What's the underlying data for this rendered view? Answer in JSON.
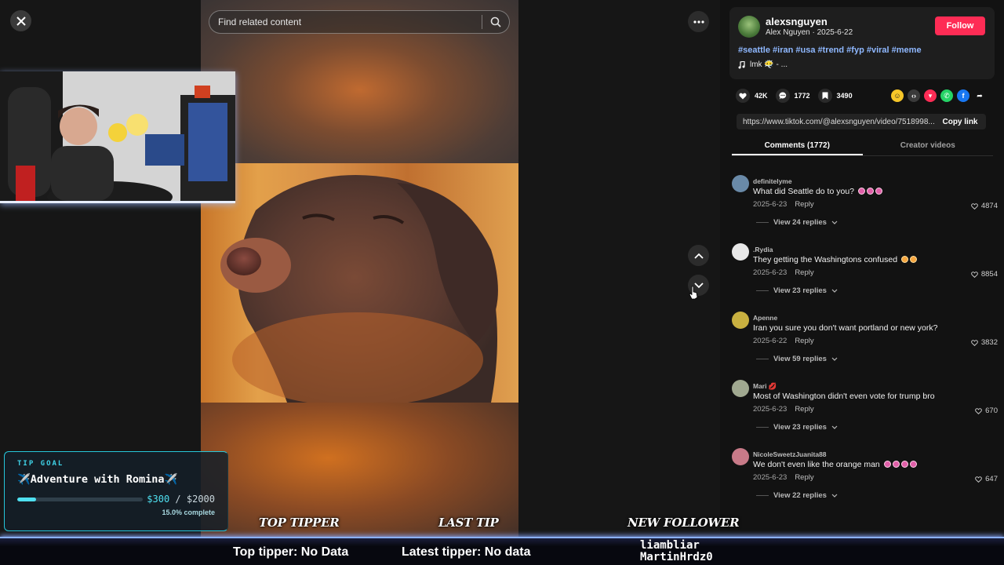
{
  "search": {
    "placeholder": "Find related content"
  },
  "author": {
    "username": "alexsnguyen",
    "display_name": "Alex Nguyen",
    "date": "2025-6-22",
    "follow_label": "Follow",
    "hashtags": "#seattle #iran #usa #trend #fyp #viral #meme",
    "music": "lmk 😶‍🌫️ - ..."
  },
  "stats": {
    "likes": "42K",
    "comments": "1772",
    "saves": "3490"
  },
  "share_icons": [
    "smile-share-icon",
    "embed-icon",
    "send-icon",
    "whatsapp-icon",
    "facebook-icon",
    "share-arrow-icon"
  ],
  "link": {
    "url": "https://www.tiktok.com/@alexsnguyen/video/7518998...",
    "copy_label": "Copy link"
  },
  "tabs": [
    {
      "label": "Comments (1772)",
      "active": true
    },
    {
      "label": "Creator videos",
      "active": false
    }
  ],
  "comments": [
    {
      "user": "definitelyme",
      "text": "What did Seattle do to you?",
      "date": "2025-6-23",
      "reply": "Reply",
      "likes": "4874",
      "replies": "View 24 replies",
      "avatar_color": "#6a8aa8"
    },
    {
      "user": ".Rydia",
      "text": "They getting the Washingtons confused",
      "date": "2025-6-23",
      "reply": "Reply",
      "likes": "8854",
      "replies": "View 23 replies",
      "avatar_color": "#e8e8e8"
    },
    {
      "user": "Apenne",
      "text": "Iran you sure you don't want portland or new york?",
      "date": "2025-6-22",
      "reply": "Reply",
      "likes": "3832",
      "replies": "View 59 replies",
      "avatar_color": "#c8b040"
    },
    {
      "user": "Mari 💋",
      "text": "Most of Washington didn't even vote for trump bro",
      "date": "2025-6-23",
      "reply": "Reply",
      "likes": "670",
      "replies": "View 23 replies",
      "avatar_color": "#a0a890"
    },
    {
      "user": "NicoleSweetzJuanita88",
      "text": "We don't even like the orange man",
      "date": "2025-6-23",
      "reply": "Reply",
      "likes": "647",
      "replies": "View 22 replies",
      "avatar_color": "#c87a88"
    }
  ],
  "tip_goal": {
    "label": "TIP GOAL",
    "title": "✈️Adventure with Romina✈️",
    "current": "$300",
    "separator": "/",
    "target": "$2000",
    "progress_fraction": 0.15,
    "percent_text": "15.0% complete"
  },
  "overlay": {
    "top_tipper_label": "TOP TIPPER",
    "last_tip_label": "LAST TIP",
    "new_follower_label": "NEW FOLLOWER",
    "top_tipper_text": "Top tipper: No Data",
    "latest_tipper_text": "Latest tipper: No data",
    "follower_line1": "liambliar",
    "follower_line2": "MartinHrdz0"
  },
  "colors": {
    "follow": "#fe2c55",
    "hashtag": "#8fb8ff",
    "tip_accent": "#4fe0f0"
  }
}
